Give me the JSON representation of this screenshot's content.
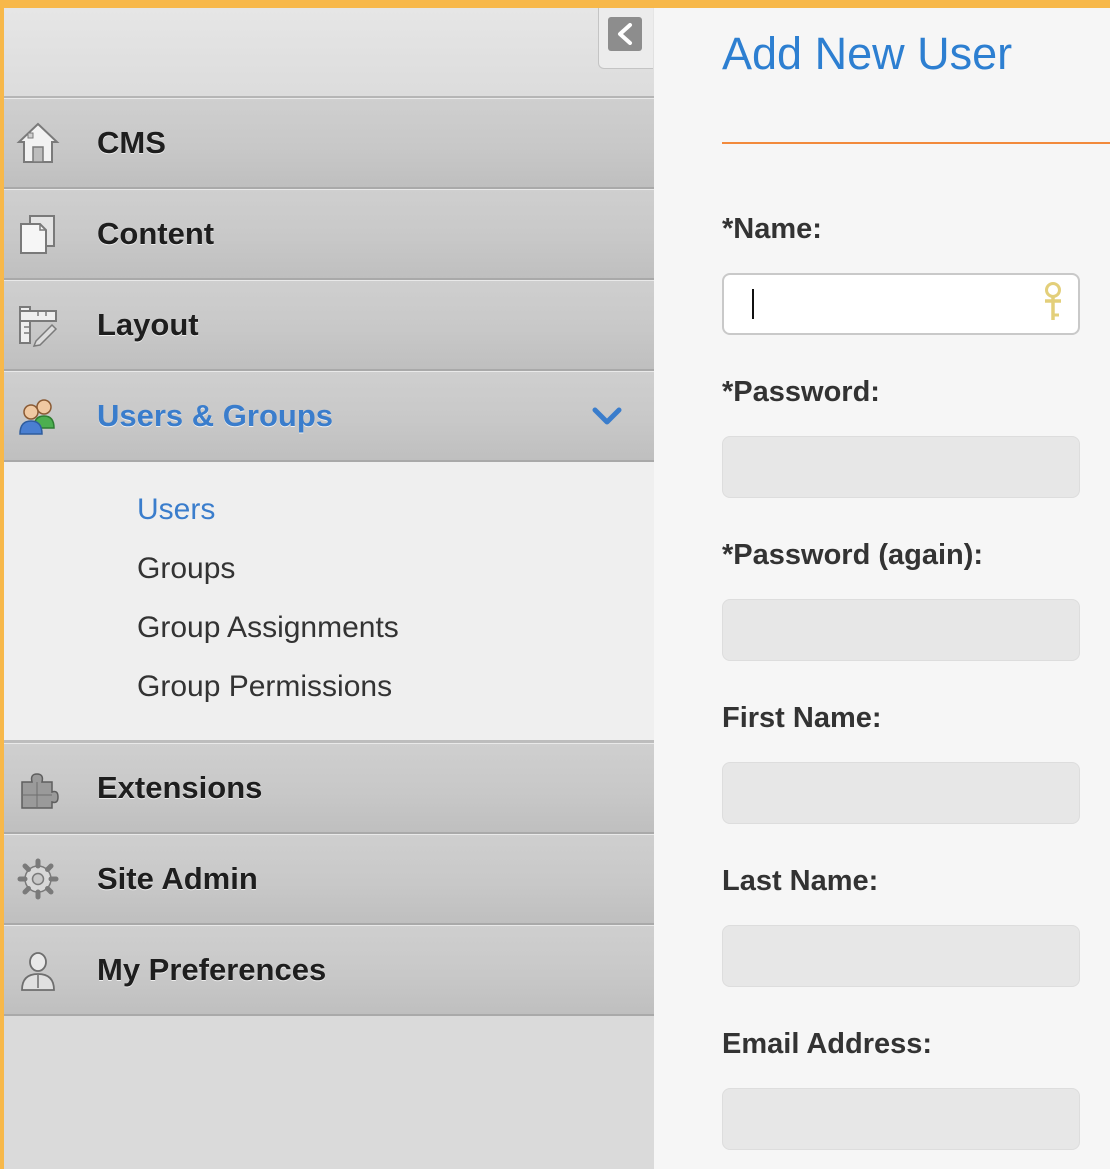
{
  "sidebar": {
    "collapse_icon": "chevron-left-icon",
    "items": [
      {
        "label": "CMS",
        "icon": "house-icon",
        "active": false
      },
      {
        "label": "Content",
        "icon": "documents-icon",
        "active": false
      },
      {
        "label": "Layout",
        "icon": "layout-ruler-icon",
        "active": false
      },
      {
        "label": "Users & Groups",
        "icon": "users-icon",
        "active": true,
        "expanded": true
      },
      {
        "label": "Extensions",
        "icon": "puzzle-icon",
        "active": false
      },
      {
        "label": "Site Admin",
        "icon": "gear-icon",
        "active": false
      },
      {
        "label": "My Preferences",
        "icon": "person-icon",
        "active": false
      }
    ],
    "submenu": [
      {
        "label": "Users",
        "current": true
      },
      {
        "label": "Groups",
        "current": false
      },
      {
        "label": "Group Assignments",
        "current": false
      },
      {
        "label": "Group Permissions",
        "current": false
      }
    ]
  },
  "main": {
    "title": "Add New User",
    "fields": [
      {
        "label": "*Name:",
        "value": "",
        "focused": true
      },
      {
        "label": "*Password:",
        "value": ""
      },
      {
        "label": "*Password (again):",
        "value": ""
      },
      {
        "label": "First Name:",
        "value": ""
      },
      {
        "label": "Last Name:",
        "value": ""
      },
      {
        "label": "Email Address:",
        "value": ""
      }
    ]
  },
  "colors": {
    "accent_blue": "#3a7dcc",
    "title_blue": "#2d7fd1",
    "rule_orange": "#f28a3c",
    "frame_orange": "#f7b84a"
  }
}
